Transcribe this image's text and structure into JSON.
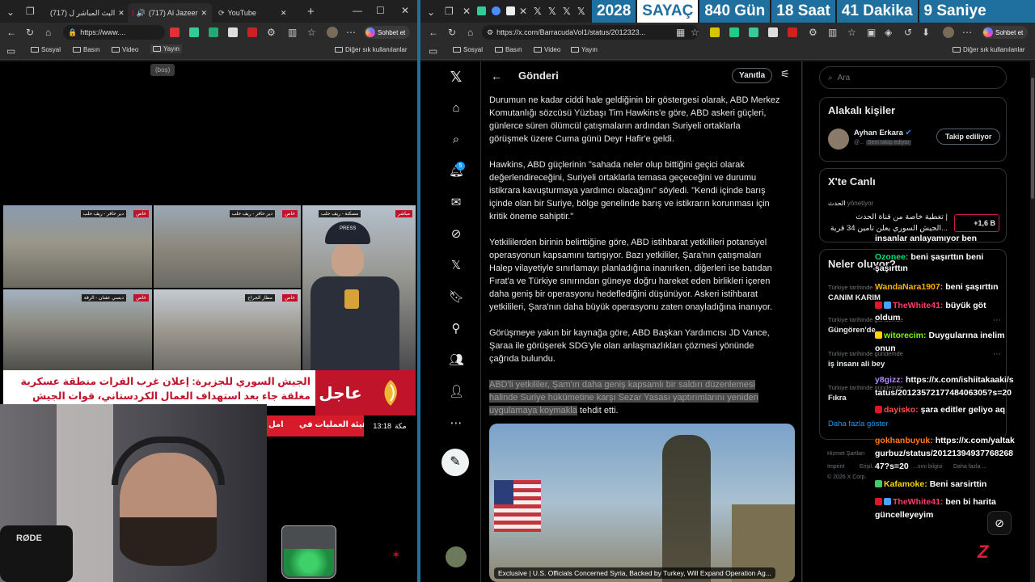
{
  "left_browser": {
    "tabs": [
      {
        "label": "(717) البث المباشر ل"
      },
      {
        "label": "(717) Al Jazeer"
      },
      {
        "label": "YouTube"
      }
    ],
    "url": "https://www....",
    "copilot": "Sohbet et",
    "bookmarks": [
      "Sosyal",
      "Basın",
      "Video",
      "Yayın"
    ],
    "other_bookmarks": "Diğer sık kullanılanlar",
    "tooltip": "(boş)"
  },
  "counter": {
    "year": "2028",
    "label": "SAYAÇ",
    "days": "840 Gün",
    "hours": "18 Saat",
    "minutes": "41 Dakika",
    "seconds": "9 Saniye"
  },
  "right_browser": {
    "url": "https://x.com/BarracudaVol1/status/2012323...",
    "copilot": "Sohbet et",
    "bookmarks": [
      "Sosyal",
      "Basın",
      "Video",
      "Yayın"
    ],
    "other_bookmarks": "Diğer sık kullanılanlar"
  },
  "broadcast": {
    "cell_tags": [
      "خاص",
      "خاص",
      "مباشر",
      "خاص",
      "خاص"
    ],
    "cell_places": [
      "دير حافر - ريف حلب",
      "دير حافر - ريف حلب",
      "مسكنة - ريف حلب",
      "دبسي عفنان - الرقة",
      "مطار الجراح"
    ],
    "press": "PRESS",
    "breaking": "عاجل",
    "headline1": "الجيش السوري للجزيرة: إعلان غرب الفرات منطقة عسكرية",
    "headline2": "مغلقة جاء بعد استهداف العمال الكردستاني، قوات الجيش",
    "ticker": "هيئة العمليات في",
    "ticker2": "امل",
    "time": "13:18",
    "city": "مكة",
    "mic": "RØDE"
  },
  "x": {
    "header": "Gönderi",
    "reply_btn": "Yanıtla",
    "notif_count": "5",
    "paragraphs": [
      "Durumun ne kadar ciddi hale geldiğinin bir göstergesi olarak, ABD Merkez Komutanlığı sözcüsü Yüzbaşı Tim Hawkins'e göre, ABD askeri güçleri, günlerce süren ölümcül çatışmaların ardından Suriyeli ortaklarla görüşmek üzere Cuma günü Deyr Hafir'e geldi.",
      "Hawkins, ABD güçlerinin \"sahada neler olup bittiğini geçici olarak değerlendireceğini, Suriyeli ortaklarla temasa geçeceğini ve durumu istikrara kavuşturmaya yardımcı olacağını\" söyledi. \"Kendi içinde barış içinde olan bir Suriye, bölge genelinde barış ve istikrarın korunması için kritik öneme sahiptir.\"",
      "Yetkililerden birinin belirttiğine göre, ABD istihbarat yetkilileri potansiyel operasyonun kapsamını tartışıyor. Bazı yetkililer, Şara'nın çatışmaları Halep vilayetiyle sınırlamayı planladığına inanırken, diğerleri ise batıdan Fırat'a ve Türkiye sınırından güneye doğru hareket eden birlikleri içeren daha geniş bir operasyonu hedeflediğini düşünüyor. Askeri istihbarat yetkilileri, Şara'nın daha büyük operasyonu zaten onayladığına inanıyor.",
      "Görüşmeye yakın bir kaynağa göre, ABD Başkan Yardımcısı JD Vance, Şaraa ile görüşerek SDG'yle olan anlaşmazlıkları çözmesi yönünde çağrıda bulundu."
    ],
    "highlight": "ABD'li yetkililer, Şam'ın daha geniş kapsamlı bir saldırı düzenlemesi halinde Suriye hükümetine karşı Sezar Yasası yaptırımlarını yeniden uygulamaya koymakla",
    "highlight_tail": " tehdit etti.",
    "image_caption": "Exclusive | U.S. Officials Concerned Syria, Backed by Turkey, Will Expand Operation Ag...",
    "search_placeholder": "Ara",
    "related_title": "Alakalı kişiler",
    "related_name": "Ayhan Erkara",
    "related_handle": "@...",
    "related_sub": "Seni takip ediyor",
    "follow_btn": "Takip ediliyor",
    "live_title": "X'te Canlı",
    "live_host": "الحدث",
    "live_host_sub": "yönetiyor",
    "live_text1": "تغطية خاصة من قناة الحدث |",
    "live_text2": "الجيش السوري يعلن تأمين 34 قرية...",
    "live_count": "+1,6 B",
    "trends_title": "Neler oluyor?",
    "trends": [
      {
        "meta": "Türkiye tarihinde gündemde",
        "name": "CANIM KARIM"
      },
      {
        "meta": "Türkiye tarihinde gündemde",
        "name": "Güngören'de"
      },
      {
        "meta": "Türkiye tarihinde gündemde",
        "name": ""
      },
      {
        "meta": "Türkiye tarihinde gündemde",
        "name": "iş insanı ali bey"
      },
      {
        "meta": "Türkiye tarihinde gündemde",
        "name": "Fıkra"
      }
    ],
    "show_more": "Daha fazla göster",
    "footer1": "Hizmet Şartları",
    "footer2": "Imprint",
    "footer3": "Erişil...",
    "footer4": "...sını bilgisi",
    "footer5": "Daha fazla ...",
    "copyright": "© 2026 X Corp."
  },
  "chat": [
    {
      "user": "",
      "text": "insanlar anlayamıyor ben",
      "color": "#ffffff"
    },
    {
      "user": "Ozonee:",
      "text": "beni şaşırttın beni",
      "color": "#00e676"
    },
    {
      "user": "",
      "text": "şaşırttın",
      "color": "#ffffff"
    },
    {
      "user": "WandaNara1907:",
      "text": "beni şaşırttın",
      "color": "#ffb000"
    },
    {
      "user": "TheWhite41:",
      "text": "büyük göt",
      "color": "#ff3b6b"
    },
    {
      "user": "",
      "text": "oldum",
      "color": "#ffffff"
    },
    {
      "user": "witorecim:",
      "text": "Duygularına inelim",
      "color": "#7cfc00"
    },
    {
      "user": "",
      "text": "onun",
      "color": "#ffffff"
    },
    {
      "user": "y8gizz:",
      "text": "https://x.com/ishiitakaaki/s",
      "color": "#b18cff"
    },
    {
      "user": "",
      "text": "tatus/2012357217748406305?s=20",
      "color": "#ffffff"
    },
    {
      "user": "dayisko:",
      "text": "şara editler geliyo aq",
      "color": "#ff4d4d"
    },
    {
      "user": "gokhanbuyuk:",
      "text": "https://x.com/yaltak",
      "color": "#ff7a1a"
    },
    {
      "user": "",
      "text": "gurbuz/status/20121394937768268",
      "color": "#ffffff"
    },
    {
      "user": "",
      "text": "47?s=20",
      "color": "#ffffff"
    },
    {
      "user": "Kafamoke:",
      "text": "Beni sarsirttin",
      "color": "#ffd400"
    },
    {
      "user": "TheWhite41:",
      "text": "ben bi harita",
      "color": "#ff3b6b"
    },
    {
      "user": "",
      "text": "güncelleyeyim",
      "color": "#ffffff"
    }
  ]
}
